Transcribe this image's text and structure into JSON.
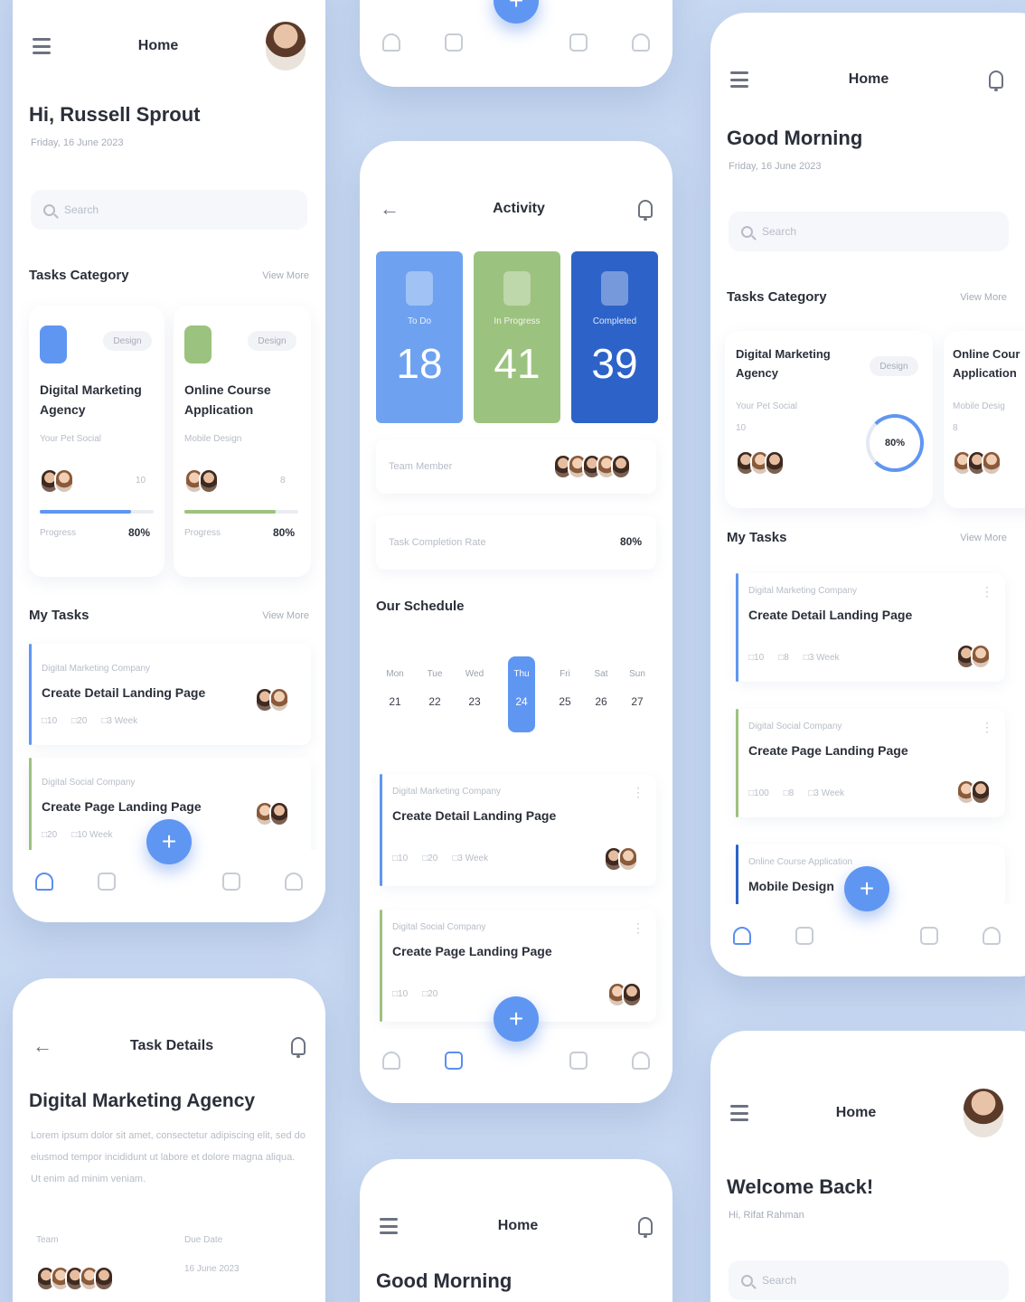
{
  "colors": {
    "background": "#c7d8f1",
    "accent": "#5f96f2",
    "green": "#9cc27f",
    "dark_blue": "#2d63c8"
  },
  "home1": {
    "title": "Home",
    "greeting": "Hi, Russell Sprout",
    "date": "Friday, 16 June 2023",
    "search_placeholder": "Search",
    "category_heading": "Tasks Category",
    "view_more": "View More",
    "categories": [
      {
        "tag": "Design",
        "title_line1": "Digital Marketing",
        "title_line2": "Agency",
        "subtitle": "Your Pet Social",
        "count": "10",
        "progress_label": "Progress",
        "progress": "80%"
      },
      {
        "tag": "Design",
        "title_line1": "Online Course",
        "title_line2": "Application",
        "subtitle": "Mobile Design",
        "count": "8",
        "progress_label": "Progress",
        "progress": "80%"
      }
    ],
    "tasks_heading": "My Tasks",
    "tasks": [
      {
        "category": "Digital Marketing Company",
        "name": "Create Detail Landing Page",
        "meta": [
          "10",
          "20",
          "3 Week"
        ]
      },
      {
        "category": "Digital Social Company",
        "name": "Create Page Landing Page",
        "meta": [
          "20",
          "10 Week"
        ]
      }
    ]
  },
  "activity": {
    "title": "Activity",
    "stats": [
      {
        "label": "To Do",
        "value": "18"
      },
      {
        "label": "In Progress",
        "value": "41"
      },
      {
        "label": "Completed",
        "value": "39"
      }
    ],
    "team_label": "Team Member",
    "team_progress_label": "Task Completion Rate",
    "team_progress": "80%",
    "schedule_heading": "Our Schedule",
    "days": [
      {
        "name": "Mon",
        "date": "21"
      },
      {
        "name": "Tue",
        "date": "22"
      },
      {
        "name": "Wed",
        "date": "23"
      },
      {
        "name": "Thu",
        "date": "24"
      },
      {
        "name": "Fri",
        "date": "25"
      },
      {
        "name": "Sat",
        "date": "26"
      },
      {
        "name": "Sun",
        "date": "27"
      }
    ],
    "tasks": [
      {
        "category": "Digital Marketing Company",
        "name": "Create Detail Landing Page",
        "meta": [
          "10",
          "20",
          "3 Week"
        ]
      },
      {
        "category": "Digital Social Company",
        "name": "Create Page Landing Page",
        "meta": [
          "10",
          "20"
        ]
      }
    ]
  },
  "home2": {
    "title": "Home",
    "greeting": "Good Morning",
    "date": "Friday, 16 June 2023",
    "search_placeholder": "Search",
    "category_heading": "Tasks Category",
    "view_more": "View More",
    "category": {
      "tag": "Design",
      "title_line1": "Digital Marketing",
      "title_line2": "Agency",
      "subtitle": "Your Pet Social",
      "count": "10",
      "progress": "80%"
    },
    "category_partial": {
      "title_line1": "Online Cour",
      "title_line2": "Application",
      "subtitle": "Mobile Desig",
      "count": "8"
    },
    "tasks_heading": "My Tasks",
    "tasks": [
      {
        "category": "Digital Marketing Company",
        "name": "Create Detail Landing Page",
        "meta": [
          "10",
          "8",
          "3 Week"
        ]
      },
      {
        "category": "Digital Social Company",
        "name": "Create Page Landing Page",
        "meta": [
          "100",
          "8",
          "3 Week"
        ]
      },
      {
        "category": "Online Course Application",
        "name": "Mobile Design"
      }
    ]
  },
  "task_details": {
    "title": "Task Details",
    "heading": "Digital Marketing Agency",
    "description": "Lorem ipsum dolor sit amet, consectetur adipiscing elit, sed do eiusmod tempor incididunt ut labore et dolore magna aliqua. Ut enim ad minim veniam.",
    "team_label": "Team",
    "due_label": "Due Date",
    "due_value": "16 June 2023"
  },
  "home3": {
    "title": "Home",
    "greeting": "Good Morning"
  },
  "home4": {
    "title": "Home",
    "greeting": "Welcome Back!",
    "sub": "Hi, Rifat Rahman",
    "search_placeholder": "Search"
  }
}
